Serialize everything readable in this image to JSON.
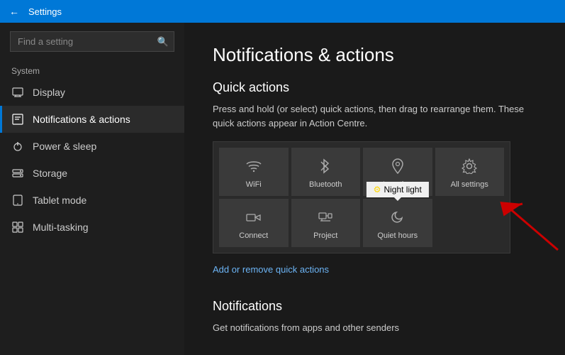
{
  "titlebar": {
    "back_icon": "←",
    "title": "Settings"
  },
  "sidebar": {
    "search_placeholder": "Find a setting",
    "search_icon": "🔍",
    "section": "System",
    "items": [
      {
        "id": "display",
        "label": "Display",
        "icon": "🖥"
      },
      {
        "id": "notifications",
        "label": "Notifications & actions",
        "icon": "☐",
        "active": true
      },
      {
        "id": "power",
        "label": "Power & sleep",
        "icon": "⏻"
      },
      {
        "id": "storage",
        "label": "Storage",
        "icon": "🗄"
      },
      {
        "id": "tablet",
        "label": "Tablet mode",
        "icon": "⬜"
      },
      {
        "id": "multitasking",
        "label": "Multi-tasking",
        "icon": "⊞"
      }
    ]
  },
  "content": {
    "page_title": "Notifications & actions",
    "quick_actions": {
      "title": "Quick actions",
      "description": "Press and hold (or select) quick actions, then drag to rearrange them. These quick actions appear in Action Centre.",
      "tiles": [
        {
          "id": "wifi",
          "icon": "wifi",
          "label": "WiFi"
        },
        {
          "id": "bluetooth",
          "icon": "bluetooth",
          "label": "Bluetooth"
        },
        {
          "id": "location",
          "icon": "location",
          "label": "Location"
        },
        {
          "id": "allsettings",
          "icon": "settings",
          "label": "All settings"
        },
        {
          "id": "connect",
          "icon": "connect",
          "label": "Connect"
        },
        {
          "id": "project",
          "icon": "project",
          "label": "Project"
        },
        {
          "id": "quiet",
          "icon": "moon",
          "label": "Quiet hours",
          "has_tooltip": true,
          "tooltip": "Night light"
        }
      ],
      "add_link": "Add or remove quick actions"
    },
    "notifications": {
      "title": "Notifications",
      "description": "Get notifications from apps and other senders"
    }
  }
}
